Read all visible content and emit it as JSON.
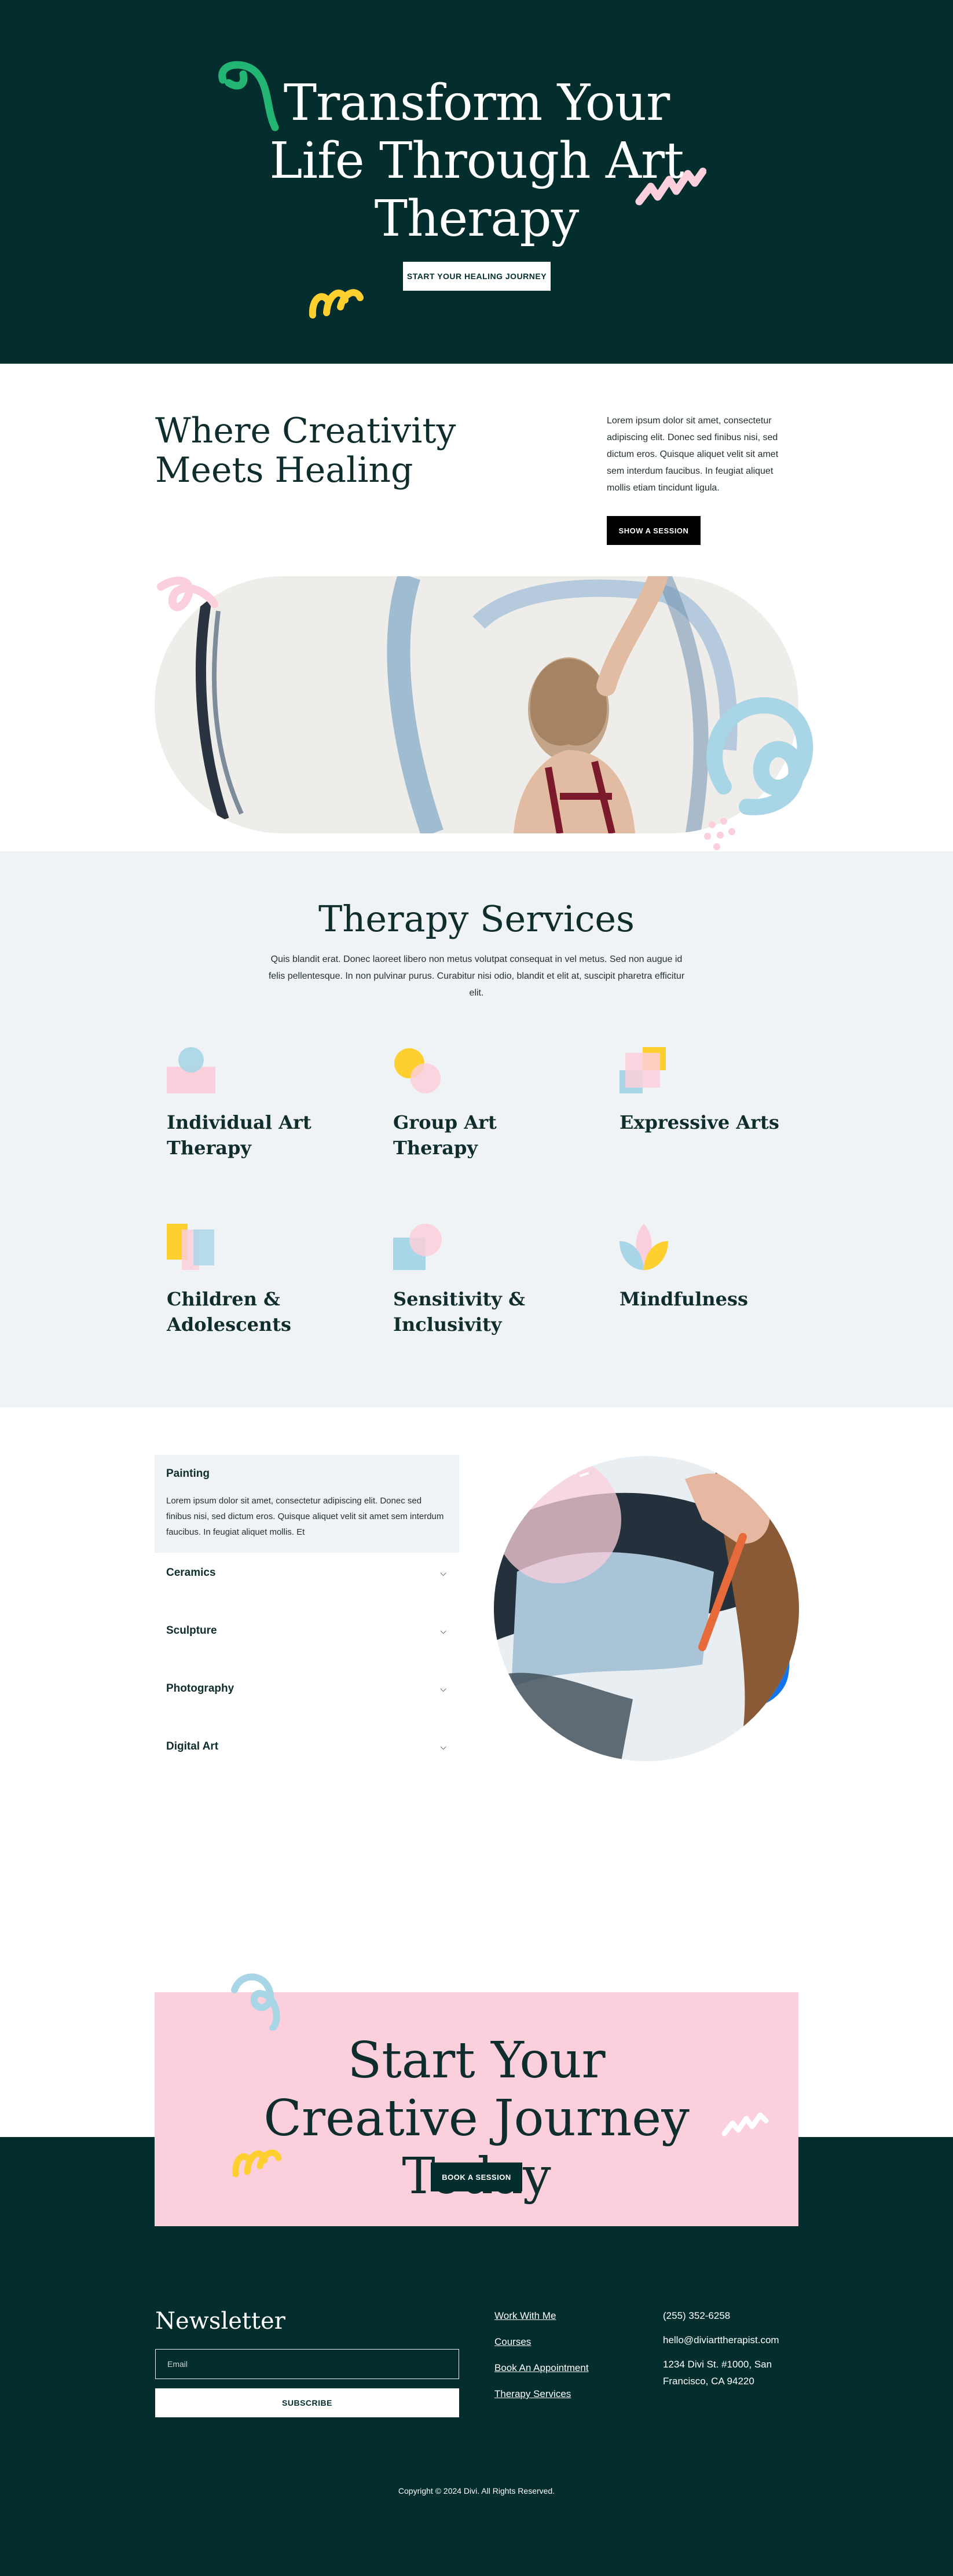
{
  "hero": {
    "title": "Transform Your Life Through Art Therapy",
    "cta": "START YOUR HEALING JOURNEY"
  },
  "intro": {
    "title": "Where Creativity Meets Healing",
    "text": "Lorem ipsum dolor sit amet, consectetur adipiscing elit. Donec sed finibus nisi, sed dictum eros. Quisque aliquet velit sit amet sem interdum faucibus. In feugiat aliquet mollis etiam tincidunt ligula.",
    "cta": "SHOW A SESSION"
  },
  "services": {
    "title": "Therapy Services",
    "description": "Quis blandit erat. Donec laoreet libero non metus volutpat consequat in vel metus. Sed non augue id felis pellentesque. In non pulvinar purus. Curabitur nisi odio, blandit et elit at, suscipit pharetra efficitur elit.",
    "items": [
      {
        "label": "Individual Art Therapy",
        "icon": "circle-square-icon"
      },
      {
        "label": "Group Art Therapy",
        "icon": "two-circles-icon"
      },
      {
        "label": "Expressive Arts",
        "icon": "overlapping-squares-icon"
      },
      {
        "label": "Children & Adolescents",
        "icon": "bars-icon"
      },
      {
        "label": "Sensitivity & Inclusivity",
        "icon": "square-circle-icon"
      },
      {
        "label": "Mindfulness",
        "icon": "lotus-icon"
      }
    ]
  },
  "disciplines": {
    "open": {
      "title": "Painting",
      "body": "Lorem ipsum dolor sit amet, consectetur adipiscing elit. Donec sed finibus nisi, sed dictum eros. Quisque aliquet velit sit amet sem interdum faucibus. In feugiat aliquet mollis. Et"
    },
    "closed": [
      "Ceramics",
      "Sculpture",
      "Photography",
      "Digital Art"
    ]
  },
  "cta": {
    "title": "Start Your Creative Journey Today",
    "button": "BOOK A SESSION"
  },
  "footer": {
    "newsletter_title": "Newsletter",
    "email_placeholder": "Email",
    "subscribe": "SUBSCRIBE",
    "links": [
      "Work With Me",
      "Courses",
      "Book An Appointment",
      "Therapy Services"
    ],
    "phone": "(255) 352-6258",
    "email": "hello@diviarttherapist.com",
    "address": "1234 Divi St. #1000, San Francisco, CA 94220",
    "copyright": "Copyright © 2024 Divi. All Rights Reserved."
  },
  "colors": {
    "dark_green": "#032e2d",
    "pink": "#fbcfdb",
    "light_blue": "#a9d6e6",
    "yellow": "#fed02f",
    "green": "#22b573",
    "blue": "#1273eb"
  }
}
